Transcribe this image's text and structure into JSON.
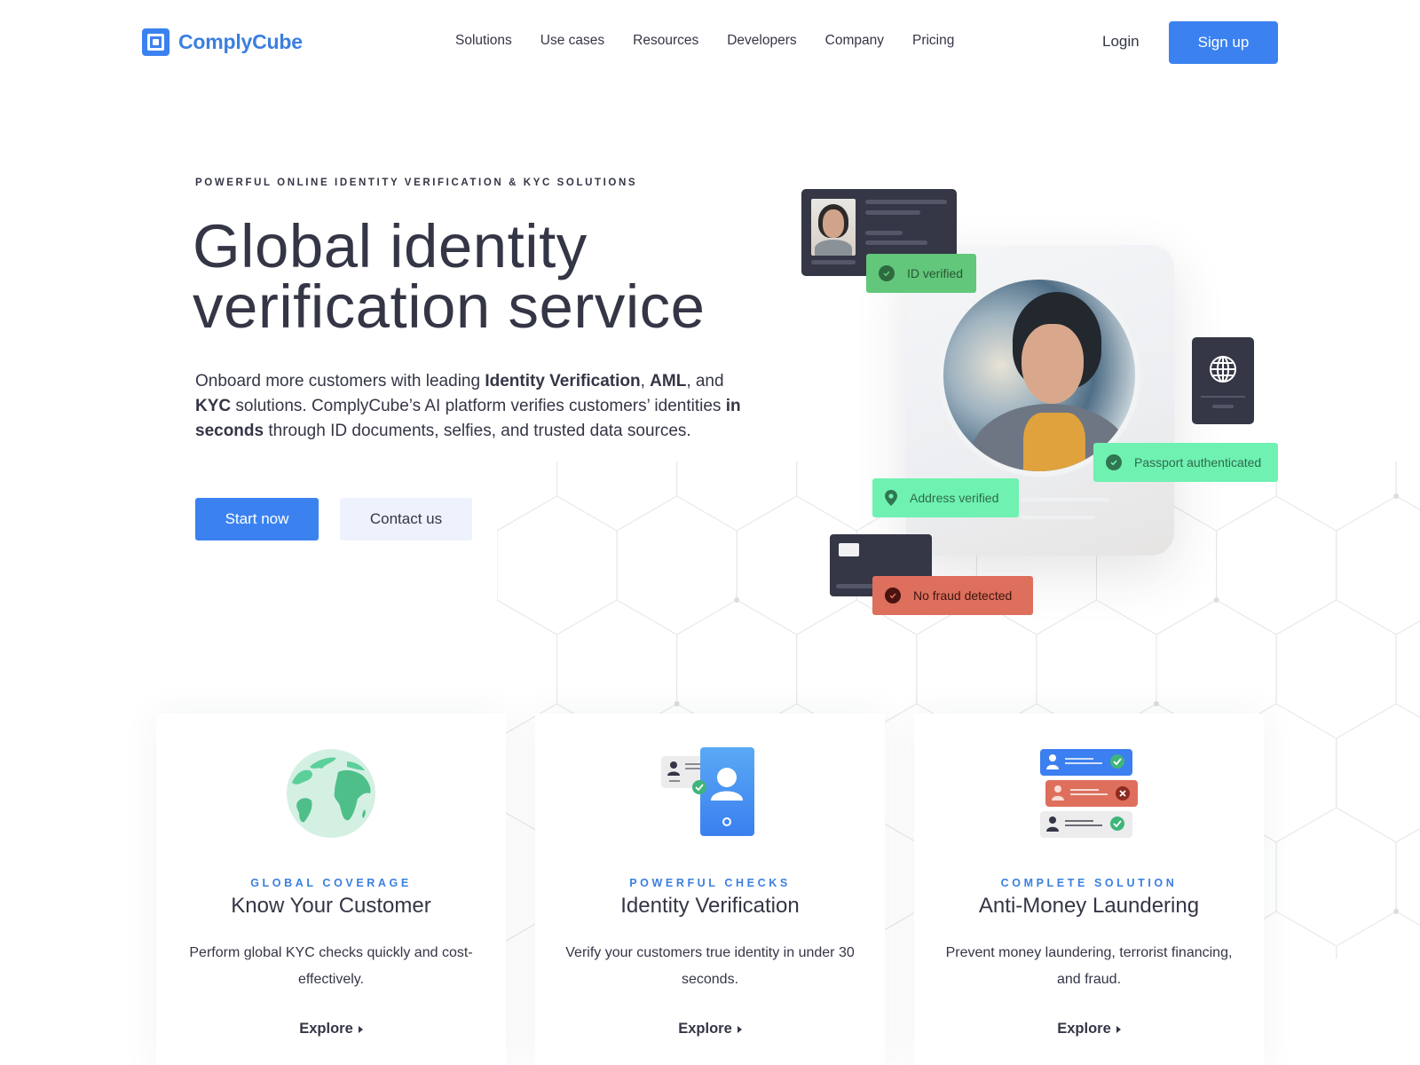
{
  "header": {
    "logo_text": "ComplyCube",
    "nav": [
      "Solutions",
      "Use cases",
      "Resources",
      "Developers",
      "Company",
      "Pricing"
    ],
    "login_label": "Login",
    "signup_label": "Sign up"
  },
  "hero": {
    "eyebrow": "POWERFUL ONLINE IDENTITY VERIFICATION & KYC SOLUTIONS",
    "title_line1": "Global identity",
    "title_line2": "verification service",
    "desc": {
      "p1": "Onboard more customers with leading ",
      "b1": "Identity Verification",
      "p2": ", ",
      "b2": "AML",
      "p3": ", and ",
      "b3": "KYC",
      "p4": " solutions. ComplyCube’s AI platform verifies customers’ identities ",
      "b4": "in seconds",
      "p5": " through ID documents, selfies, and trusted data sources."
    },
    "primary_button": "Start now",
    "secondary_button": "Contact us"
  },
  "illustration": {
    "badges": {
      "id": "ID verified",
      "passport": "Passport authenticated",
      "address": "Address verified",
      "fraud": "No fraud detected"
    },
    "icons": [
      "id-card-icon",
      "passport-globe-icon",
      "bank-card-icon",
      "check-circle-icon",
      "location-pin-icon"
    ],
    "colors": {
      "success_dark": "#62c77a",
      "success_light": "#6ff1b1",
      "alert": "#dd6f5c",
      "doc": "#353746"
    }
  },
  "cards": [
    {
      "icon": "globe-icon",
      "eyebrow": "GLOBAL COVERAGE",
      "title": "Know Your Customer",
      "desc": "Perform global KYC checks quickly and cost-effectively.",
      "link": "Explore"
    },
    {
      "icon": "phone-identity-icon",
      "eyebrow": "POWERFUL CHECKS",
      "title": "Identity Verification",
      "desc": "Verify your customers true identity in under 30 seconds.",
      "link": "Explore"
    },
    {
      "icon": "screening-list-icon",
      "eyebrow": "COMPLETE SOLUTION",
      "title": "Anti-Money Laundering",
      "desc": "Prevent money laundering, terrorist financing, and fraud.",
      "link": "Explore"
    }
  ],
  "colors": {
    "brand": "#3b82f0",
    "text": "#343646",
    "secondary_button_bg": "#edf2fc"
  }
}
